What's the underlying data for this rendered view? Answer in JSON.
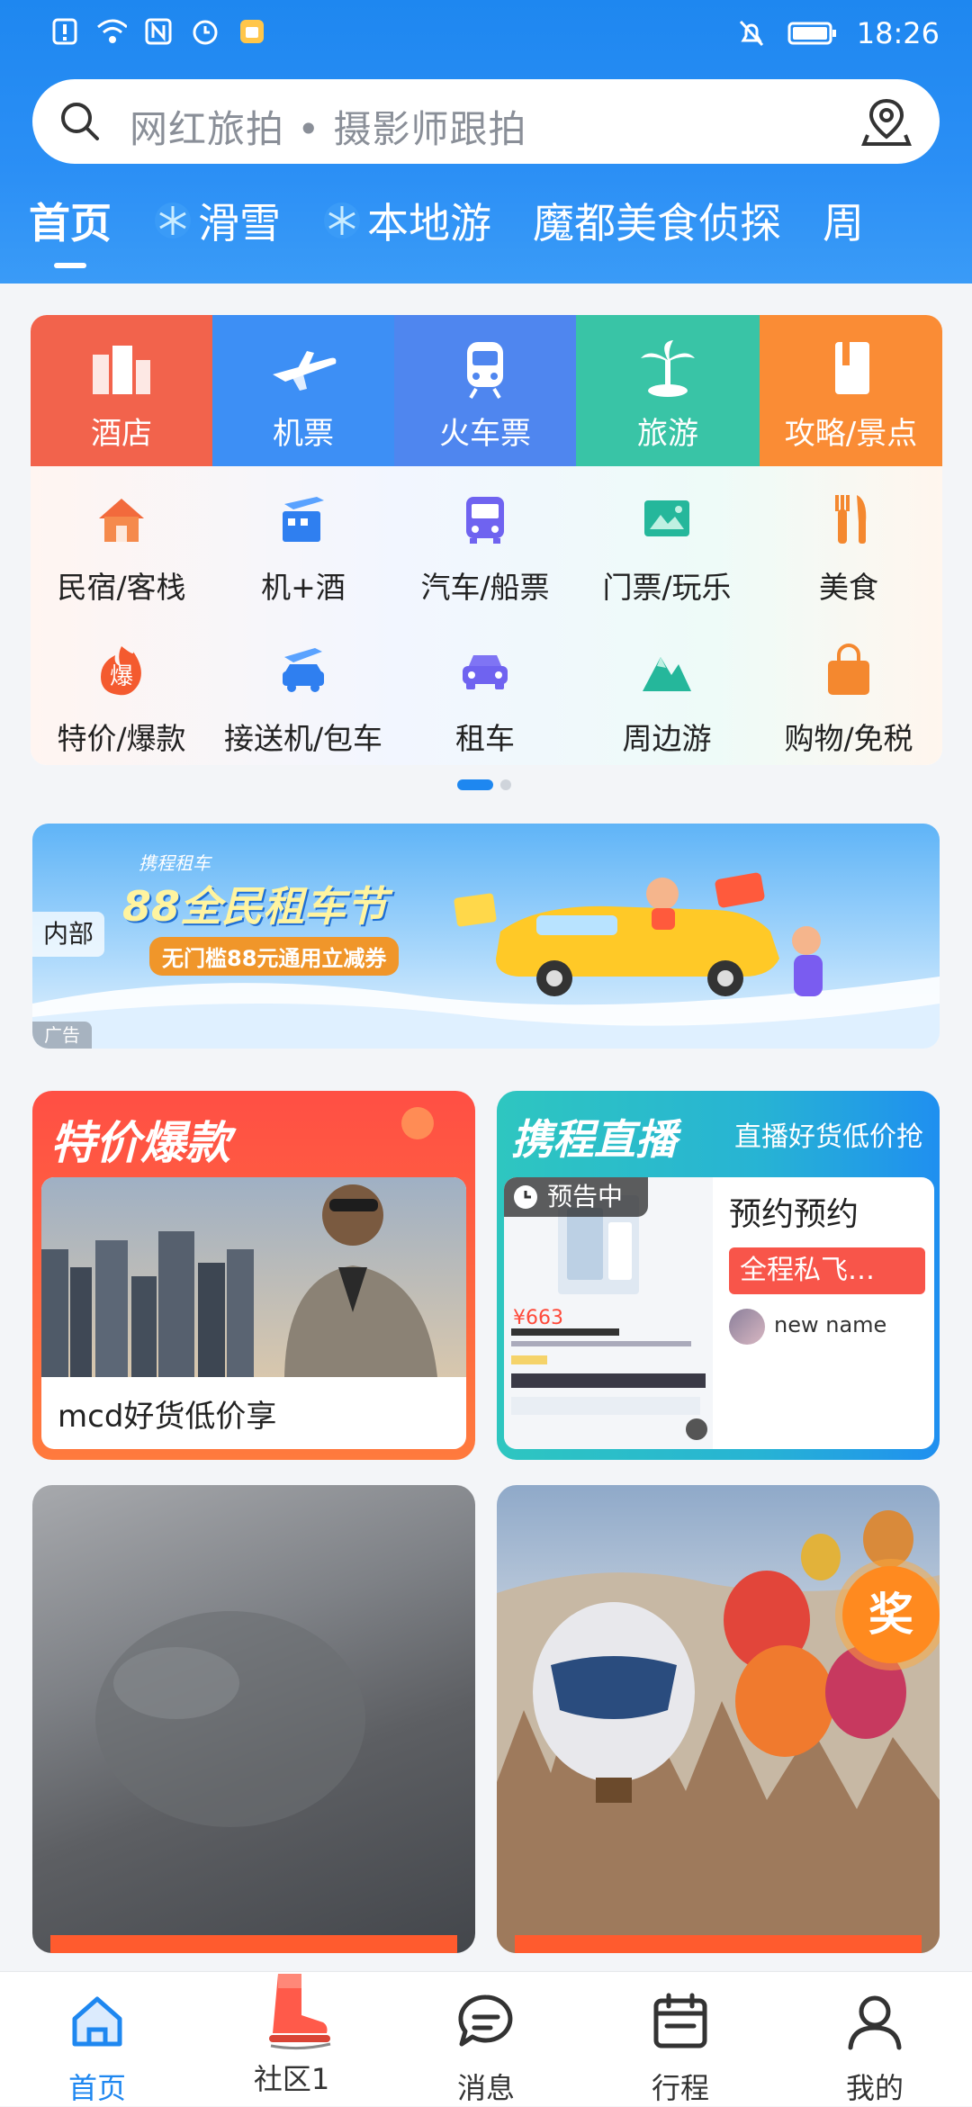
{
  "status": {
    "time": "18:26"
  },
  "search": {
    "placeholder": "网红旅拍 • 摄影师跟拍"
  },
  "tabs": [
    {
      "label": "首页",
      "active": true
    },
    {
      "label": "滑雪",
      "snow": true
    },
    {
      "label": "本地游",
      "snow": true
    },
    {
      "label": "魔都美食侦探"
    },
    {
      "label": "周"
    }
  ],
  "categories": [
    {
      "label": "酒店",
      "icon": "hotel-icon",
      "color": "#f2634c"
    },
    {
      "label": "机票",
      "icon": "plane-icon",
      "color": "#3d8ff5"
    },
    {
      "label": "火车票",
      "icon": "train-icon",
      "color": "#4f86ef"
    },
    {
      "label": "旅游",
      "icon": "palm-tree-icon",
      "color": "#39c4a6"
    },
    {
      "label": "攻略/景点",
      "icon": "guide-book-icon",
      "color": "#fa8c35"
    }
  ],
  "services": [
    {
      "label": "民宿/客栈",
      "icon": "house-icon"
    },
    {
      "label": "机+酒",
      "icon": "flight-hotel-icon"
    },
    {
      "label": "汽车/船票",
      "icon": "bus-icon"
    },
    {
      "label": "门票/玩乐",
      "icon": "ticket-icon"
    },
    {
      "label": "美食",
      "icon": "fork-knife-icon"
    },
    {
      "label": "特价/爆款",
      "icon": "hot-deal-icon",
      "badge": "爆"
    },
    {
      "label": "接送机/包车",
      "icon": "airport-car-icon"
    },
    {
      "label": "租车",
      "icon": "car-icon"
    },
    {
      "label": "周边游",
      "icon": "mountain-icon"
    },
    {
      "label": "购物/免税",
      "icon": "shopping-bag-icon"
    }
  ],
  "banner": {
    "internal_tag": "内部",
    "brand": "携程租车",
    "title": "88全民租车节",
    "subtitle": "无门槛88元通用立减券",
    "ad_tag": "广告"
  },
  "promo_left": {
    "title": "特价爆款",
    "caption": "mcd好货低价享"
  },
  "promo_right": {
    "title": "携程直播",
    "subtitle": "直播好货低价抢",
    "preview_badge": "预告中",
    "product_title": "预约预约",
    "tag": "全程私飞…",
    "user": "new name",
    "price": "¥663"
  },
  "feed": {
    "award_badge": "奖"
  },
  "nav": [
    {
      "label": "首页",
      "icon": "home-icon",
      "active": true
    },
    {
      "label": "社区1",
      "icon": "community-boot-icon"
    },
    {
      "label": "消息",
      "icon": "message-icon"
    },
    {
      "label": "行程",
      "icon": "calendar-icon"
    },
    {
      "label": "我的",
      "icon": "profile-icon"
    }
  ]
}
